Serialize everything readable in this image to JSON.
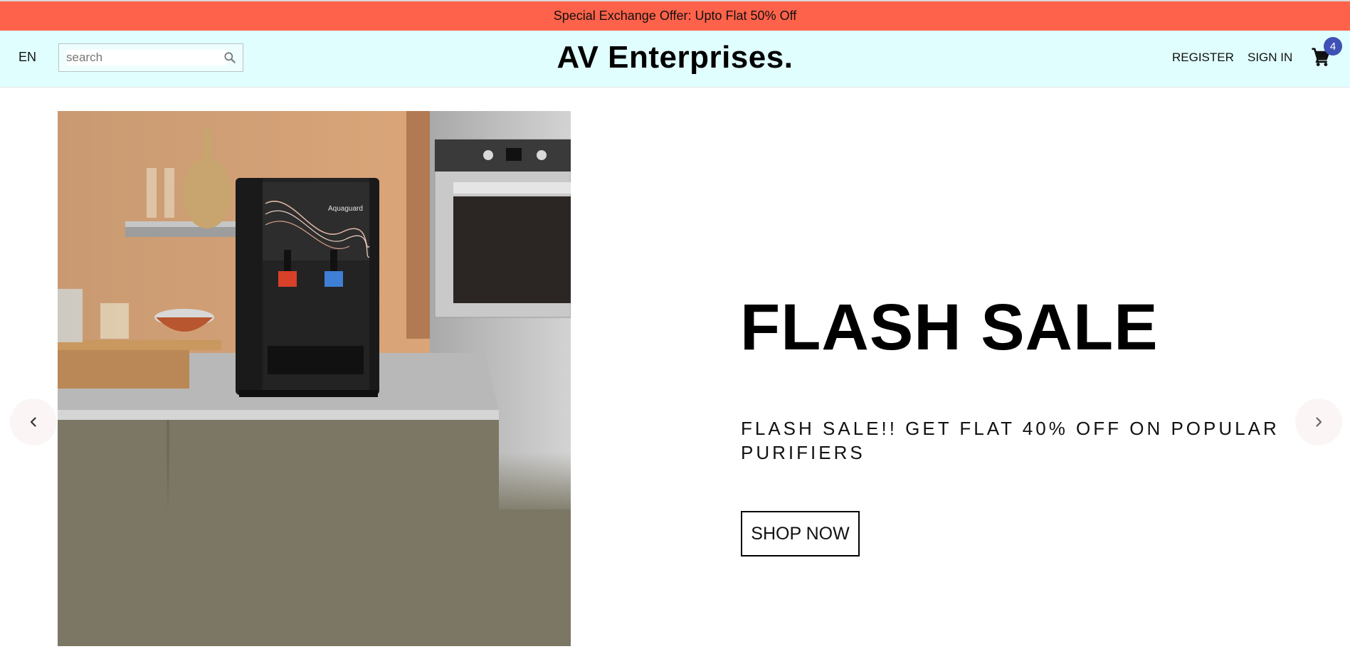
{
  "announcement": {
    "text": "Special Exchange Offer: Upto Flat 50% Off"
  },
  "header": {
    "language": "EN",
    "search": {
      "placeholder": "search",
      "value": ""
    },
    "logo": "AV Enterprises.",
    "register_label": "REGISTER",
    "signin_label": "SIGN IN",
    "cart_count": "4"
  },
  "slider": {
    "title": "FLASH SALE",
    "description": "FLASH SALE!! GET FLAT 40% OFF ON POPULAR PURIFIERS",
    "cta_label": "SHOP NOW",
    "image_brand": "Aquaguard"
  },
  "icons": {
    "search": "search-icon",
    "cart": "shopping-cart-icon",
    "prev": "chevron-left-icon",
    "next": "chevron-right-icon"
  },
  "colors": {
    "announcement_bg": "#ff624a",
    "navbar_bg": "#e0fefe",
    "badge_bg": "#3f51b5"
  }
}
